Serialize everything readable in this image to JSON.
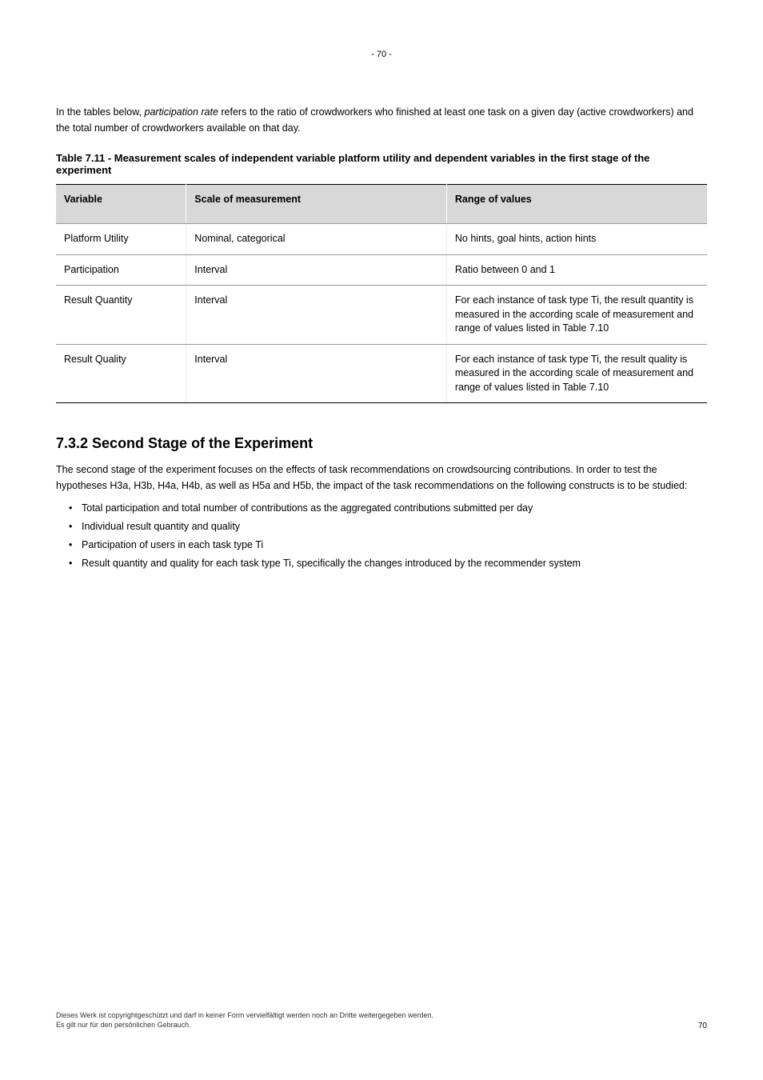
{
  "page_top_num": "- 70 -",
  "intro": {
    "part1": "In the tables below, ",
    "emph": "participation rate ",
    "part2": "refers to the ratio of crowdworkers who finished at least one task on a given day (active crowdworkers) and the total number of crowdworkers available on that day."
  },
  "table_title": "Table 7.11 - Measurement scales of independent variable platform utility and dependent variables in the first stage of the experiment",
  "table": {
    "headers": [
      "Variable",
      "Scale of measurement",
      "Range of values"
    ],
    "rows": [
      [
        "Platform Utility",
        "Nominal, categorical",
        "No hints, goal hints, action hints"
      ],
      [
        "Participation",
        "Interval",
        "Ratio between 0 and 1"
      ],
      [
        "Result Quantity",
        "Interval",
        "For each instance of task type Ti, the result quantity is measured in the according scale of measurement and range of values listed in Table 7.10"
      ],
      [
        "Result Quality",
        "Interval",
        "For each instance of task type Ti, the result quality is measured in the according scale of measurement and range of values listed in Table 7.10"
      ]
    ]
  },
  "section": {
    "heading": "7.3.2 Second Stage of the Experiment",
    "para": "The second stage of the experiment focuses on the effects of task recommendations on crowdsourcing contributions. In order to test the hypotheses H3a, H3b, H4a, H4b, as well as H5a and H5b, the impact of the task recommendations on the following constructs is to be studied:",
    "bullets": [
      "Total participation and total number of contributions as the aggregated contributions submitted per day",
      "Individual result quantity and quality",
      "Participation of users in each task type Ti",
      "Result quantity and quality for each task type Ti, specifically the changes introduced by the recommender system"
    ]
  },
  "footer_left_line1": "Dieses Werk ist copyrightgeschützt und darf in keiner Form vervielfältigt werden noch an Dritte weitergegeben werden.",
  "footer_left_line2": "Es gilt nur für den persönlichen Gebrauch.",
  "footer_right": "70"
}
